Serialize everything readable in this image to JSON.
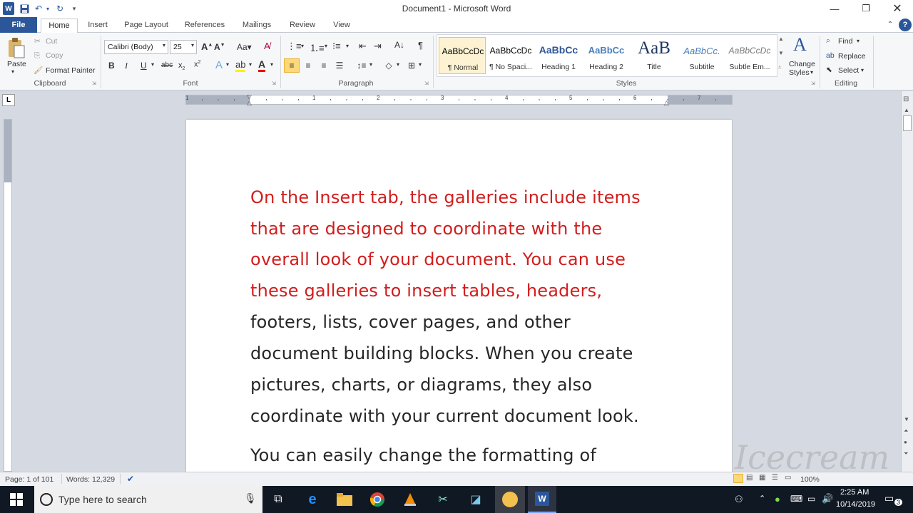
{
  "window": {
    "title": "Document1 - Microsoft Word",
    "help": "?"
  },
  "tabs": [
    "File",
    "Home",
    "Insert",
    "Page Layout",
    "References",
    "Mailings",
    "Review",
    "View"
  ],
  "clipboard": {
    "group": "Clipboard",
    "paste": "Paste",
    "cut": "Cut",
    "copy": "Copy",
    "format_painter": "Format Painter"
  },
  "font": {
    "group": "Font",
    "name": "Calibri (Body)",
    "size": "25"
  },
  "paragraph": {
    "group": "Paragraph"
  },
  "styles": {
    "group": "Styles",
    "items": [
      {
        "preview": "AaBbCcDc",
        "label": "¶ Normal"
      },
      {
        "preview": "AaBbCcDc",
        "label": "¶ No Spaci..."
      },
      {
        "preview": "AaBbCc",
        "label": "Heading 1"
      },
      {
        "preview": "AaBbCc",
        "label": "Heading 2"
      },
      {
        "preview": "AaB",
        "label": "Title"
      },
      {
        "preview": "AaBbCc.",
        "label": "Subtitle"
      },
      {
        "preview": "AaBbCcDc",
        "label": "Subtle Em..."
      }
    ],
    "change_styles": [
      "Change",
      "Styles"
    ]
  },
  "editing": {
    "group": "Editing",
    "find": "Find",
    "replace": "Replace",
    "select": "Select"
  },
  "ruler": {
    "numbers": [
      "1",
      "1",
      "2",
      "3",
      "4",
      "5",
      "6",
      "7"
    ]
  },
  "document": {
    "lines": [
      {
        "text": "On the Insert tab, the galleries include items",
        "red": true
      },
      {
        "text": "that are designed to coordinate with the",
        "red": true
      },
      {
        "text": "overall look of your document.  You can use",
        "red": true
      },
      {
        "text": "these galleries to insert tables, headers,",
        "red": true
      },
      {
        "text": "footers, lists, cover pages, and other",
        "red": false
      },
      {
        "text": "document  building blocks. When you create",
        "red": false
      },
      {
        "text": "pictures, charts, or diagrams, they also",
        "red": false
      },
      {
        "text": "coordinate with your current document  look.",
        "red": false
      },
      {
        "text": "You can easily change the formatting of",
        "red": false
      }
    ]
  },
  "status": {
    "page": "Page: 1 of 101",
    "words": "Words: 12,329",
    "zoom": "100%"
  },
  "taskbar": {
    "search_placeholder": "Type here to search",
    "time": "2:25 AM",
    "date": "10/14/2019",
    "notifications": "3"
  },
  "watermark": "Icecream APPS",
  "colors": {
    "file_tab": "#2b579a",
    "red_text": "#d21d1d",
    "taskbar": "#101823"
  }
}
